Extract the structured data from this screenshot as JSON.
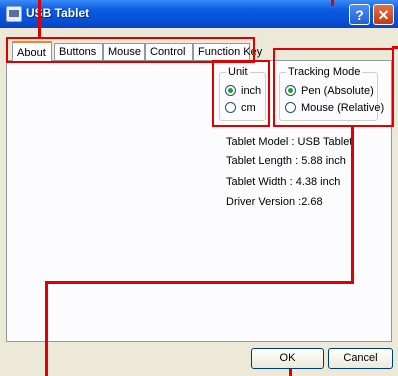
{
  "window": {
    "title": "USB Tablet",
    "help_label": "?",
    "close_label": "✕"
  },
  "tabs": [
    {
      "label": "About",
      "active": true
    },
    {
      "label": "Buttons",
      "active": false
    },
    {
      "label": "Mouse",
      "active": false
    },
    {
      "label": "Control",
      "active": false
    },
    {
      "label": "Function Key",
      "active": false
    }
  ],
  "unit_group": {
    "legend": "Unit",
    "options": [
      {
        "label": "inch",
        "checked": true
      },
      {
        "label": "cm",
        "checked": false
      }
    ]
  },
  "tracking_group": {
    "legend": "Tracking Mode",
    "options": [
      {
        "label": "Pen (Absolute)",
        "checked": true
      },
      {
        "label": "Mouse (Relative)",
        "checked": false
      }
    ]
  },
  "info": {
    "model": "Tablet Model : USB Tablet",
    "length": "Tablet Length : 5.88 inch",
    "width": "Tablet Width : 4.38 inch",
    "driver": "Driver Version :2.68"
  },
  "buttons": {
    "ok": "OK",
    "cancel": "Cancel"
  },
  "colors": {
    "titlebar": "#0851d6",
    "annotation": "#e00000",
    "dialog_bg": "#ece9d8"
  }
}
